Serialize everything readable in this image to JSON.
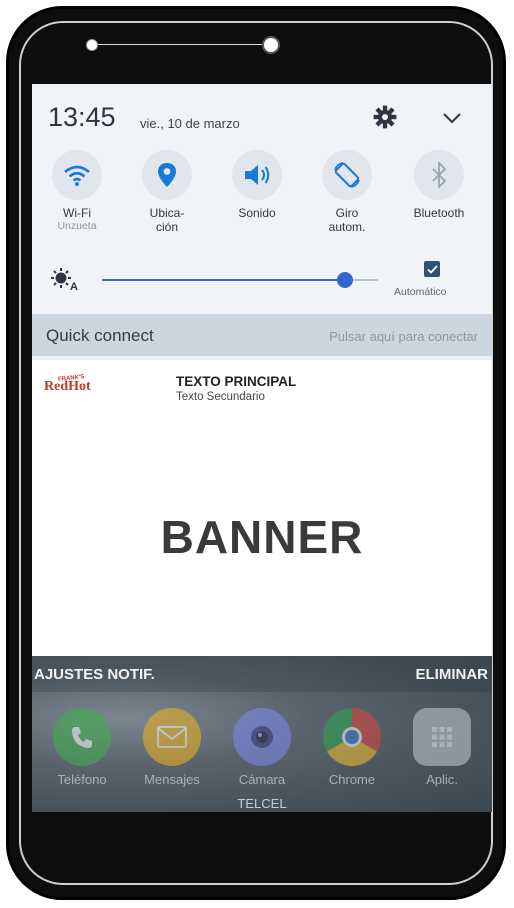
{
  "status": {
    "time": "13:45",
    "date": "vie., 10 de marzo"
  },
  "header_icons": [
    "gear-icon",
    "chevron-down-icon"
  ],
  "tiles": [
    {
      "label": "Wi-Fi",
      "sub": "Unzueta",
      "icon": "wifi-icon"
    },
    {
      "label": "Ubica-\nción",
      "sub": "",
      "icon": "location-icon"
    },
    {
      "label": "Sonido",
      "sub": "",
      "icon": "speaker-icon"
    },
    {
      "label": "Giro\nautom.",
      "sub": "",
      "icon": "rotate-icon"
    },
    {
      "label": "Bluetooth",
      "sub": "",
      "icon": "bluetooth-icon"
    }
  ],
  "brightness": {
    "level": 0.88,
    "auto_label": "Automático",
    "auto_checked": true
  },
  "quick_connect": {
    "title": "Quick connect",
    "hint": "Pulsar aquí para conectar"
  },
  "notification": {
    "brand": "RedHot",
    "brand_top": "FRANK'S",
    "title": "TEXTO PRINCIPAL",
    "subtitle": "Texto Secundario",
    "banner": "BANNER"
  },
  "actions": {
    "settings": "AJUSTES NOTIF.",
    "clear": "ELIMINAR"
  },
  "dock": [
    {
      "label": "Teléfono",
      "icon": "phone-icon",
      "color": "#3fb24a"
    },
    {
      "label": "Mensajes",
      "icon": "message-icon",
      "color": "#f1b51c"
    },
    {
      "label": "Cámara",
      "icon": "camera-icon",
      "color": "#7d8cf0"
    },
    {
      "label": "Chrome",
      "icon": "chrome-icon",
      "color": "#e0453a"
    },
    {
      "label": "Aplic.",
      "icon": "apps-icon",
      "color": "#c9ccd2"
    }
  ],
  "carrier": "TELCEL",
  "colors": {
    "accent": "#2f66d4",
    "quick_bar": "#cdd6e0",
    "tile_icon": "#1a78d6"
  }
}
